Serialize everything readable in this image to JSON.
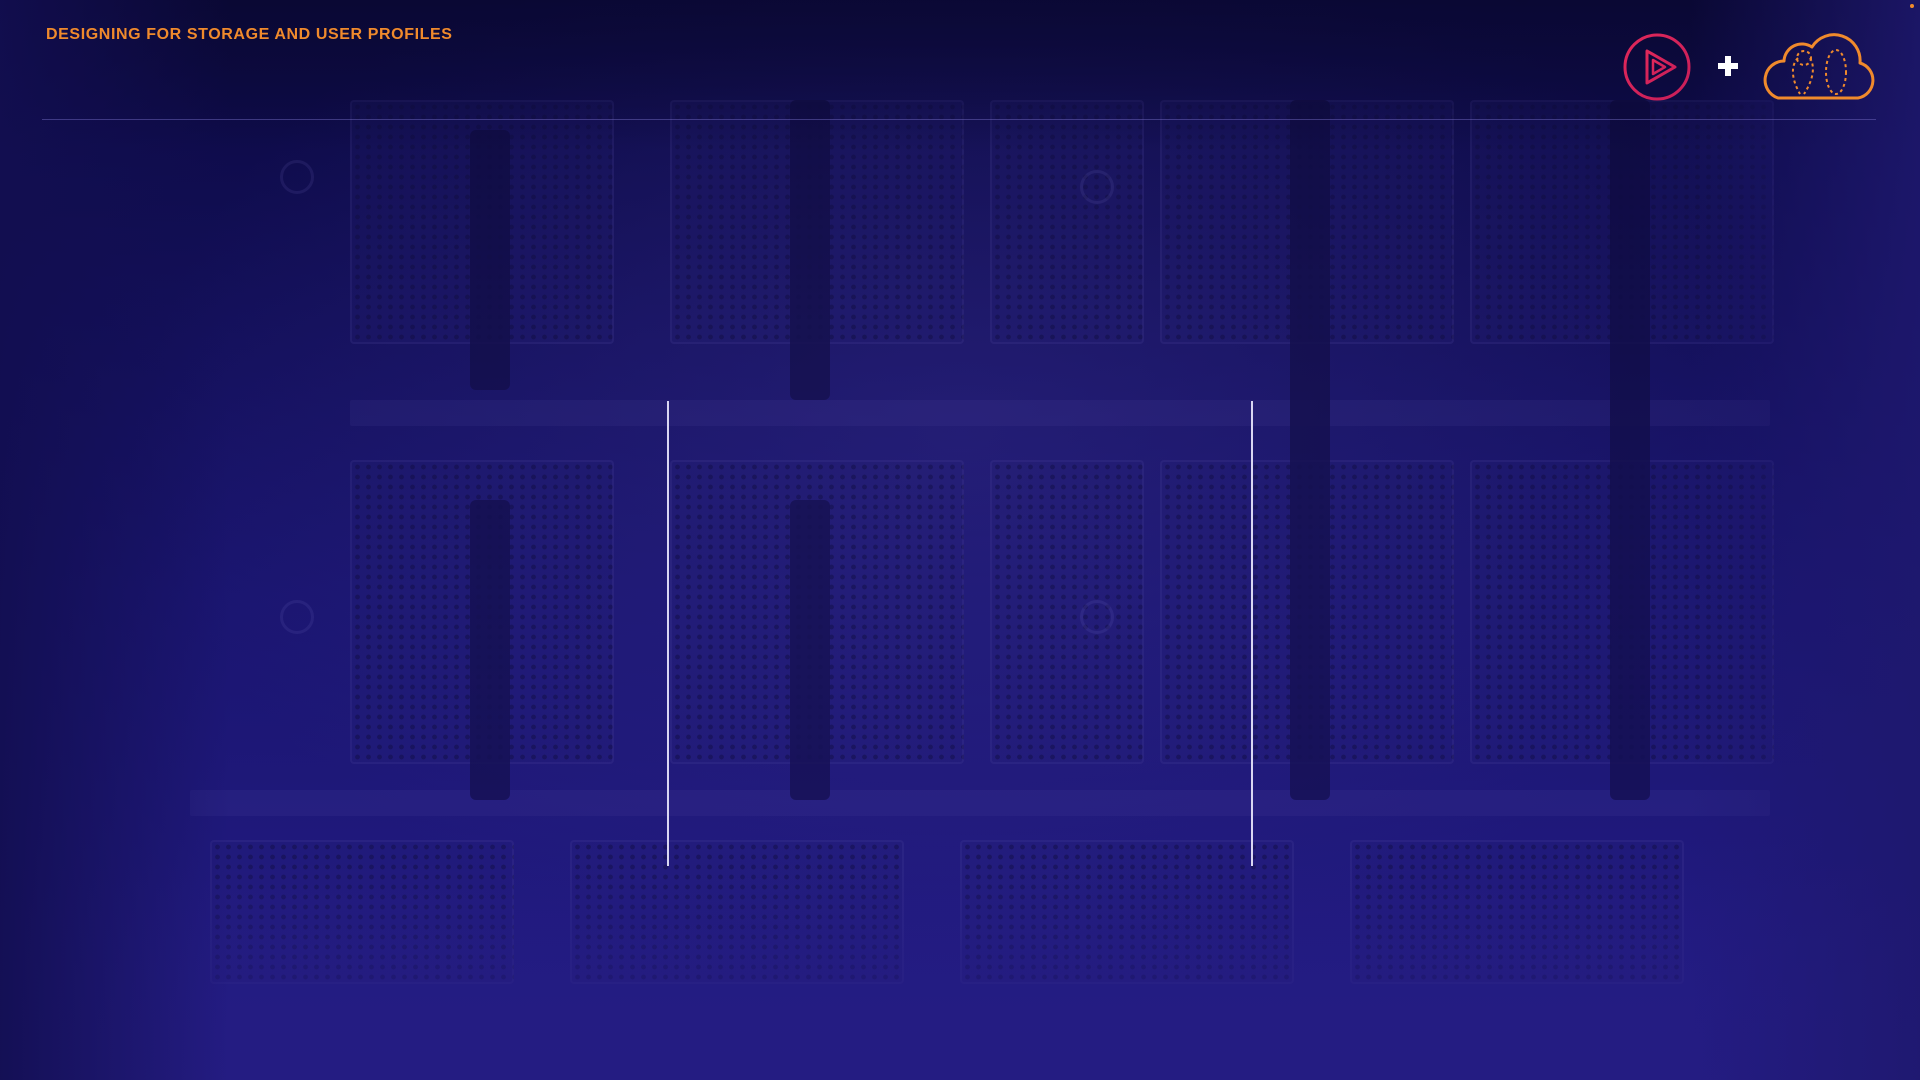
{
  "header": {
    "title": "DESIGNING FOR STORAGE AND USER PROFILES"
  },
  "logos": {
    "play_logo": "play-logo-icon",
    "plus": "plus-icon",
    "cloud_logo": "cloud-logo-icon"
  },
  "colors": {
    "accent_orange": "#f08a2c",
    "accent_pink": "#e0285a",
    "background": "#1a1570",
    "divider": "#d9d6f2"
  }
}
